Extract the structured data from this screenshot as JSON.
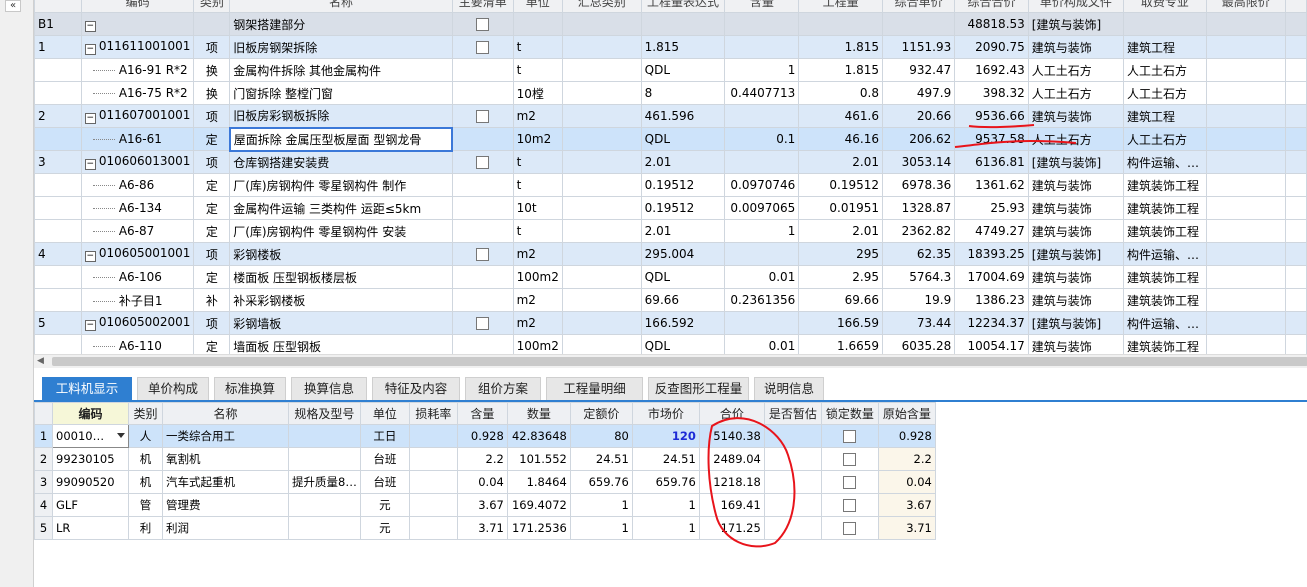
{
  "collapse_symbol": "«",
  "top_headers": [
    "编码",
    "类别",
    "名称",
    "主要清单",
    "单位",
    "汇总类别",
    "工程量表达式",
    "含量",
    "工程量",
    "综合单价",
    "综合合价",
    "单价构成文件",
    "取费专业",
    "最高限价",
    ""
  ],
  "rows": [
    {
      "type": "b1",
      "idx": "B1",
      "code": "",
      "cat": "",
      "name": "钢架搭建部分",
      "chk": true,
      "unit": "",
      "sum": "",
      "expr": "",
      "content": "",
      "qty": "",
      "price": "",
      "total": "48818.53",
      "file": "[建筑与装饰]",
      "pro": ""
    },
    {
      "type": "item",
      "idx": "1",
      "code": "011611001001",
      "cat": "项",
      "name": "旧板房钢架拆除",
      "chk": true,
      "unit": "t",
      "sum": "",
      "expr": "1.815",
      "content": "",
      "qty": "1.815",
      "price": "1151.93",
      "total": "2090.75",
      "file": "建筑与装饰",
      "pro": "建筑工程"
    },
    {
      "type": "sub",
      "idx": "",
      "code": "A16-91 R*2",
      "cat": "换",
      "name": "金属构件拆除 其他金属构件",
      "chk": false,
      "unit": "t",
      "sum": "",
      "expr": "QDL",
      "content": "1",
      "qty": "1.815",
      "price": "932.47",
      "total": "1692.43",
      "file": "人工土石方",
      "pro": "人工土石方"
    },
    {
      "type": "sub",
      "idx": "",
      "code": "A16-75 R*2",
      "cat": "换",
      "name": "门窗拆除 整樘门窗",
      "chk": false,
      "unit": "10樘",
      "sum": "",
      "expr": "8",
      "content": "0.4407713",
      "qty": "0.8",
      "price": "497.9",
      "total": "398.32",
      "file": "人工土石方",
      "pro": "人工土石方"
    },
    {
      "type": "item",
      "idx": "2",
      "code": "011607001001",
      "cat": "项",
      "name": "旧板房彩钢板拆除",
      "chk": true,
      "unit": "m2",
      "sum": "",
      "expr": "461.596",
      "content": "",
      "qty": "461.6",
      "price": "20.66",
      "total": "9536.66",
      "file": "建筑与装饰",
      "pro": "建筑工程"
    },
    {
      "type": "sel",
      "idx": "",
      "code": "A16-61",
      "cat": "定",
      "name": "屋面拆除 金属压型板屋面 型钢龙骨",
      "chk": false,
      "unit": "10m2",
      "sum": "",
      "expr": "QDL",
      "content": "0.1",
      "qty": "46.16",
      "price": "206.62",
      "total": "9537.58",
      "file": "人工土石方",
      "pro": "人工土石方"
    },
    {
      "type": "item",
      "idx": "3",
      "code": "010606013001",
      "cat": "项",
      "name": "仓库钢搭建安装费",
      "chk": true,
      "unit": "t",
      "sum": "",
      "expr": "2.01",
      "content": "",
      "qty": "2.01",
      "price": "3053.14",
      "total": "6136.81",
      "file": "[建筑与装饰]",
      "pro": "构件运输、…"
    },
    {
      "type": "sub",
      "idx": "",
      "code": "A6-86",
      "cat": "定",
      "name": "厂(库)房钢构件 零星钢构件 制作",
      "chk": false,
      "unit": "t",
      "sum": "",
      "expr": "0.19512",
      "content": "0.0970746",
      "qty": "0.19512",
      "price": "6978.36",
      "total": "1361.62",
      "file": "建筑与装饰",
      "pro": "建筑装饰工程"
    },
    {
      "type": "sub",
      "idx": "",
      "code": "A6-134",
      "cat": "定",
      "name": "金属构件运输 三类构件 运距≤5km",
      "chk": false,
      "unit": "10t",
      "sum": "",
      "expr": "0.19512",
      "content": "0.0097065",
      "qty": "0.01951",
      "price": "1328.87",
      "total": "25.93",
      "file": "建筑与装饰",
      "pro": "建筑装饰工程"
    },
    {
      "type": "sub",
      "idx": "",
      "code": "A6-87",
      "cat": "定",
      "name": "厂(库)房钢构件 零星钢构件 安装",
      "chk": false,
      "unit": "t",
      "sum": "",
      "expr": "2.01",
      "content": "1",
      "qty": "2.01",
      "price": "2362.82",
      "total": "4749.27",
      "file": "建筑与装饰",
      "pro": "建筑装饰工程"
    },
    {
      "type": "item",
      "idx": "4",
      "code": "010605001001",
      "cat": "项",
      "name": "彩钢楼板",
      "chk": true,
      "unit": "m2",
      "sum": "",
      "expr": "295.004",
      "content": "",
      "qty": "295",
      "price": "62.35",
      "total": "18393.25",
      "file": "[建筑与装饰]",
      "pro": "构件运输、…"
    },
    {
      "type": "sub",
      "idx": "",
      "code": "A6-106",
      "cat": "定",
      "name": "楼面板 压型钢板楼层板",
      "chk": false,
      "unit": "100m2",
      "sum": "",
      "expr": "QDL",
      "content": "0.01",
      "qty": "2.95",
      "price": "5764.3",
      "total": "17004.69",
      "file": "建筑与装饰",
      "pro": "建筑装饰工程"
    },
    {
      "type": "sub",
      "idx": "",
      "code": "补子目1",
      "cat": "补",
      "name": "补采彩钢楼板",
      "chk": false,
      "unit": "m2",
      "sum": "",
      "expr": "69.66",
      "content": "0.2361356",
      "qty": "69.66",
      "price": "19.9",
      "total": "1386.23",
      "file": "建筑与装饰",
      "pro": "建筑装饰工程"
    },
    {
      "type": "item",
      "idx": "5",
      "code": "010605002001",
      "cat": "项",
      "name": "彩钢墙板",
      "chk": true,
      "unit": "m2",
      "sum": "",
      "expr": "166.592",
      "content": "",
      "qty": "166.59",
      "price": "73.44",
      "total": "12234.37",
      "file": "[建筑与装饰]",
      "pro": "构件运输、…"
    },
    {
      "type": "sub",
      "idx": "",
      "code": "A6-110",
      "cat": "定",
      "name": "墙面板 压型钢板",
      "chk": false,
      "unit": "100m2",
      "sum": "",
      "expr": "QDL",
      "content": "0.01",
      "qty": "1.6659",
      "price": "6035.28",
      "total": "10054.17",
      "file": "建筑与装饰",
      "pro": "建筑装饰工程"
    }
  ],
  "tabs": [
    "工料机显示",
    "单价构成",
    "标准换算",
    "换算信息",
    "特征及内容",
    "组价方案",
    "工程量明细",
    "反查图形工程量",
    "说明信息"
  ],
  "bottom_headers": [
    "",
    "编码",
    "类别",
    "名称",
    "规格及型号",
    "单位",
    "损耗率",
    "含量",
    "数量",
    "定额价",
    "市场价",
    "合价",
    "是否暂估",
    "锁定数量",
    "原始含量"
  ],
  "bottom_rows": [
    {
      "n": "1",
      "code": "00010…",
      "cat": "人",
      "name": "一类综合用工",
      "spec": "",
      "unit": "工日",
      "loss": "",
      "content": "0.928",
      "qty": "42.83648",
      "fixed": "80",
      "market": "120",
      "total": "5140.38",
      "est": "",
      "orig": "0.928"
    },
    {
      "n": "2",
      "code": "99230105",
      "cat": "机",
      "name": "氧割机",
      "spec": "",
      "unit": "台班",
      "loss": "",
      "content": "2.2",
      "qty": "101.552",
      "fixed": "24.51",
      "market": "24.51",
      "total": "2489.04",
      "est": "",
      "orig": "2.2"
    },
    {
      "n": "3",
      "code": "99090520",
      "cat": "机",
      "name": "汽车式起重机",
      "spec": "提升质量8…",
      "unit": "台班",
      "loss": "",
      "content": "0.04",
      "qty": "1.8464",
      "fixed": "659.76",
      "market": "659.76",
      "total": "1218.18",
      "est": "",
      "orig": "0.04"
    },
    {
      "n": "4",
      "code": "GLF",
      "cat": "管",
      "name": "管理费",
      "spec": "",
      "unit": "元",
      "loss": "",
      "content": "3.67",
      "qty": "169.4072",
      "fixed": "1",
      "market": "1",
      "total": "169.41",
      "est": "",
      "orig": "3.67"
    },
    {
      "n": "5",
      "code": "LR",
      "cat": "利",
      "name": "利润",
      "spec": "",
      "unit": "元",
      "loss": "",
      "content": "3.71",
      "qty": "171.2536",
      "fixed": "1",
      "market": "1",
      "total": "171.25",
      "est": "",
      "orig": "3.71"
    }
  ],
  "colors": {
    "accent": "#2f7fd1",
    "item_row": "#dce9f8",
    "annotation": "#e8141b"
  }
}
